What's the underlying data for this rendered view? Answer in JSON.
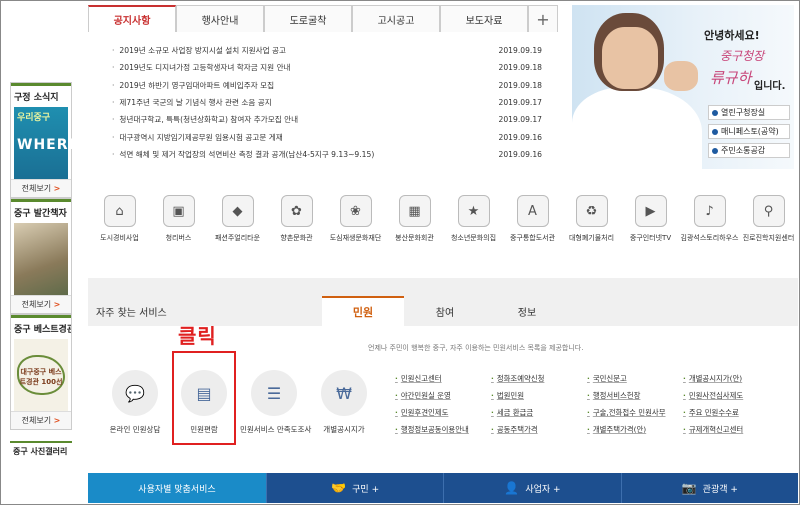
{
  "news_tabs": [
    "공지사항",
    "행사안내",
    "도로굴착",
    "고시공고",
    "보도자료",
    "+"
  ],
  "news": [
    {
      "title": "2019년 소규모 사업장 방지시설 설치 지원사업 공고",
      "date": "2019.09.19"
    },
    {
      "title": "2019년도 디지녀가정 고등학생자녀 학자금 지원 안내",
      "date": "2019.09.18"
    },
    {
      "title": "2019년 하반기 영구임대아파트 예비입주자 모집",
      "date": "2019.09.18"
    },
    {
      "title": "제71주년 국군의 날 기념식 행사 관련 소음 공지",
      "date": "2019.09.17"
    },
    {
      "title": "청년대구학교, 특특(청년상화학교) 참여자 추가모집 안내",
      "date": "2019.09.17"
    },
    {
      "title": "대구광역시 지방임기제공무원 임용시험 공고문 게재",
      "date": "2019.09.16"
    },
    {
      "title": "석면 해체 및 제거 작업장의 석면비산 측정 결과 공개(남산4-5지구 9.13~9.15)",
      "date": "2019.09.16"
    }
  ],
  "mayor": {
    "greeting": "안녕하세요!",
    "name1": "중구청장",
    "name2": "류규하",
    "suffix": "입니다.",
    "buttons": [
      "열린구청장실",
      "매니페스토(공약)",
      "주민소통공감"
    ]
  },
  "sidebar": {
    "sections": [
      {
        "title": "구정 소식지",
        "thumb_a": "우리중구",
        "thumb_b": "WHERE",
        "more": "전체보기"
      },
      {
        "title": "중구 발간책자",
        "more": "전체보기"
      },
      {
        "title": "중구 베스트경관",
        "thumb_text": "대구중구 베스트경관 100선",
        "more": "전체보기"
      }
    ],
    "last": "중구 사진갤러리",
    "more_arrow": ">"
  },
  "icon_links": [
    "도시경비사업",
    "청리버스",
    "패션주얼리타운",
    "향촌문화관",
    "도심재생문화재단",
    "봉산문화회관",
    "청소년문화의집",
    "중구통합도서관",
    "대형폐기물처리",
    "중구인터넷TV",
    "김광석스토리하우스",
    "진로진학지원센터"
  ],
  "service": {
    "title": "자주 찾는 서비스",
    "tabs": [
      "민원",
      "참여",
      "정보"
    ],
    "desc": "언제나 주민이 행복한 중구, 자주 이용하는 민원서비스 목록을 제공합니다.",
    "items": [
      "온라인 민원상담",
      "민원편람",
      "민원서비스 만족도조사",
      "개별공시지가"
    ],
    "click_label": "클릭",
    "links": [
      "민원신고센터",
      "정화조예약신청",
      "국민신문고",
      "개별공시지가(안)",
      "야간민원실 운영",
      "법원민원",
      "행정서비스헌장",
      "민원사전심사제도",
      "민원후견인제도",
      "세금 환급금",
      "구술,전화접수 민원사무",
      "주요 민원수수료",
      "행정정보공동이용안내",
      "공동주택가격",
      "개별주택가격(안)",
      "규제개혁신고센터"
    ]
  },
  "bottom_bar": [
    "사용자별 맞춤서비스",
    "구민 +",
    "사업자 +",
    "관광객 +"
  ]
}
